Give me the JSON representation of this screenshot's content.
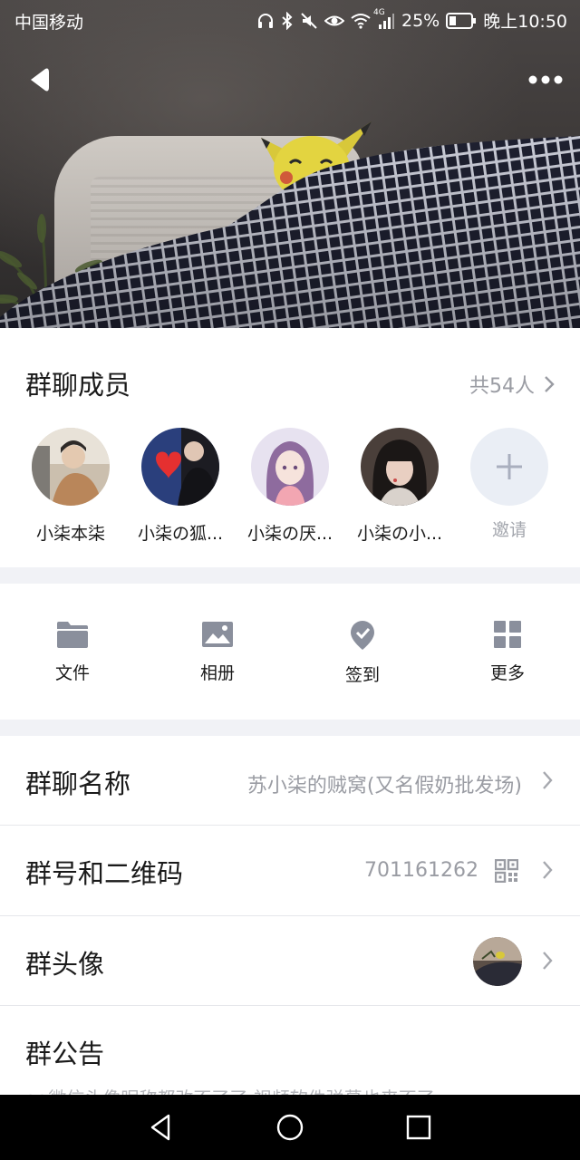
{
  "status_bar": {
    "carrier": "中国移动",
    "network": "4G",
    "battery": "25%",
    "time": "晚上10:50"
  },
  "members": {
    "title": "群聊成员",
    "count": "共54人",
    "list": [
      {
        "name": "小柒本柒"
      },
      {
        "name": "小柒の狐..."
      },
      {
        "name": "小柒の厌..."
      },
      {
        "name": "小柒の小..."
      }
    ],
    "invite_label": "邀请"
  },
  "functions": [
    {
      "label": "文件",
      "icon": "folder-icon"
    },
    {
      "label": "相册",
      "icon": "photo-album-icon"
    },
    {
      "label": "签到",
      "icon": "check-in-icon"
    },
    {
      "label": "更多",
      "icon": "grid-more-icon"
    }
  ],
  "rows": {
    "name": {
      "label": "群聊名称",
      "value": "苏小柒的贼窝(又名假奶批发场)"
    },
    "number": {
      "label": "群号和二维码",
      "value": "701161262"
    },
    "avatar": {
      "label": "群头像"
    },
    "notice": {
      "label": "群公告",
      "preview": "qq微信头像昵称都改不了了 视频软件弹幕也来不了"
    }
  },
  "colors": {
    "accent_icon": "#8a8f9c",
    "secondary_text": "#9a9ca3",
    "section_gap": "#f1f2f6"
  }
}
